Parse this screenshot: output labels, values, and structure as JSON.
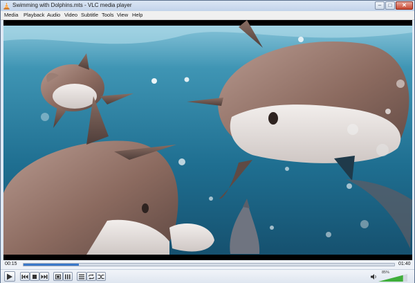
{
  "window": {
    "title": "Swimming with Dolphins.mts - VLC media player",
    "controls": [
      "minimize",
      "maximize",
      "close"
    ]
  },
  "menu": {
    "items": [
      {
        "label": "Media"
      },
      {
        "label": "Playback"
      },
      {
        "label": "Audio"
      },
      {
        "label": "Video"
      },
      {
        "label": "Subtitle"
      },
      {
        "label": "Tools"
      },
      {
        "label": "View"
      },
      {
        "label": "Help"
      }
    ]
  },
  "playback": {
    "elapsed": "00:15",
    "duration": "01:40",
    "progress": 0.15
  },
  "volume": {
    "label": "85%",
    "level": 0.85
  },
  "colors": {
    "accent": "#3a78c9",
    "volume": "#3fae3a"
  },
  "icons": {
    "app": "vlc-cone-icon",
    "play": "play-icon",
    "prev": "previous-icon",
    "stop": "stop-icon",
    "next": "next-icon",
    "fullscreen": "fullscreen-icon",
    "extended": "extended-settings-icon",
    "playlist": "playlist-icon",
    "loop": "loop-icon",
    "shuffle": "shuffle-icon",
    "mute": "speaker-icon"
  }
}
